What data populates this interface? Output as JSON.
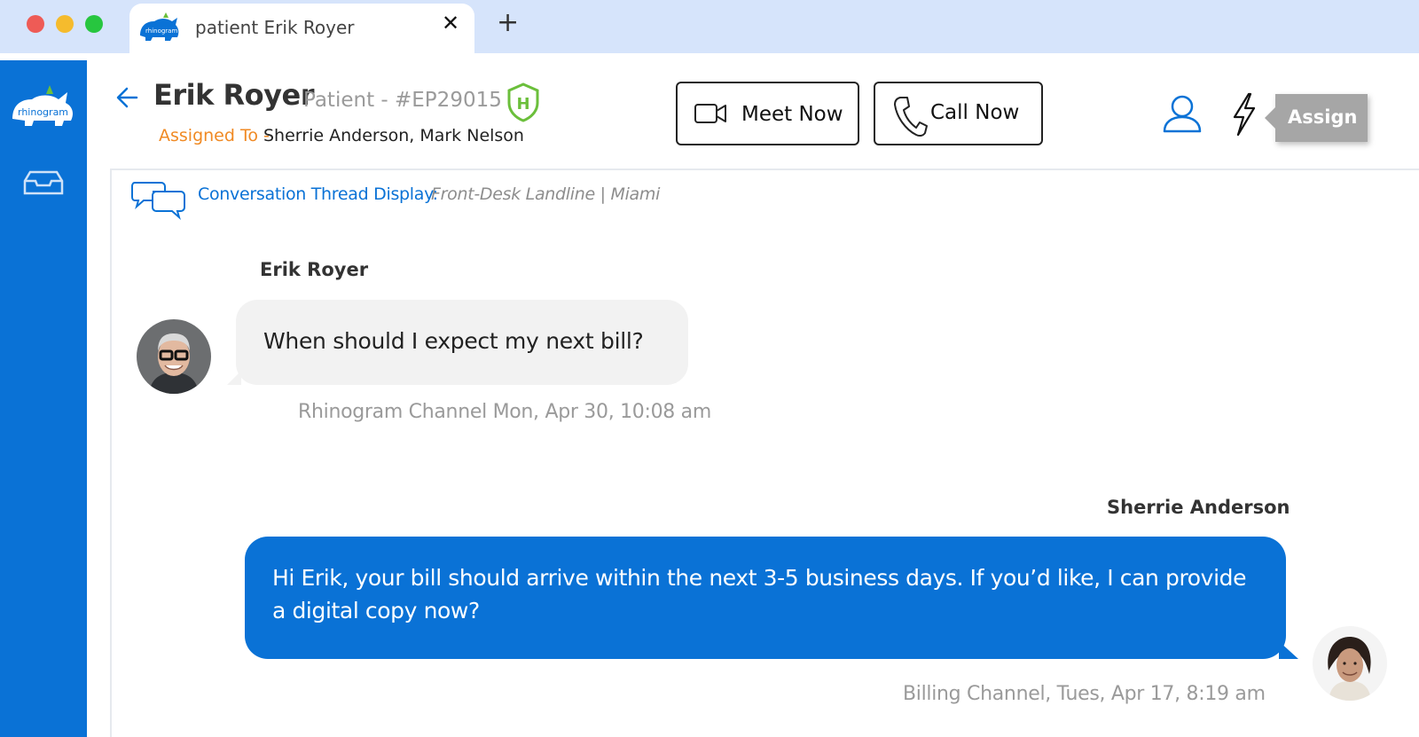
{
  "browser": {
    "tab_title": "patient Erik Royer",
    "close_glyph": "✕",
    "new_tab_glyph": "+"
  },
  "brand": {
    "name": "rhinogram",
    "primary_color": "#0a72d6",
    "accent_color": "#f08a24"
  },
  "sidebar": {
    "items": [
      {
        "icon": "rhinogram-logo-icon",
        "label": "rhinogram"
      },
      {
        "icon": "inbox-icon"
      }
    ]
  },
  "header": {
    "patient_name": "Erik Royer",
    "patient_id": "Patient - #EP29015",
    "hipaa_badge": "H",
    "assigned_label": "Assigned To -",
    "assigned_names": "Sherrie Anderson, Mark Nelson",
    "meet_now_label": "Meet Now",
    "call_now_label": "Call Now",
    "assign_label": "Assign"
  },
  "thread": {
    "label": "Conversation Thread Display:",
    "meta": "Front-Desk Landline | Miami",
    "messages": [
      {
        "sender": "Erik Royer",
        "direction": "incoming",
        "text": "When should I expect my next bill?",
        "meta": "Rhinogram Channel Mon, Apr 30, 10:08 am"
      },
      {
        "sender": "Sherrie Anderson",
        "direction": "outgoing",
        "text": "Hi Erik, your bill should arrive within the next 3-5 business days. If you’d like, I can provide a digital copy now?",
        "meta": "Billing Channel, Tues, Apr 17, 8:19 am"
      }
    ]
  }
}
